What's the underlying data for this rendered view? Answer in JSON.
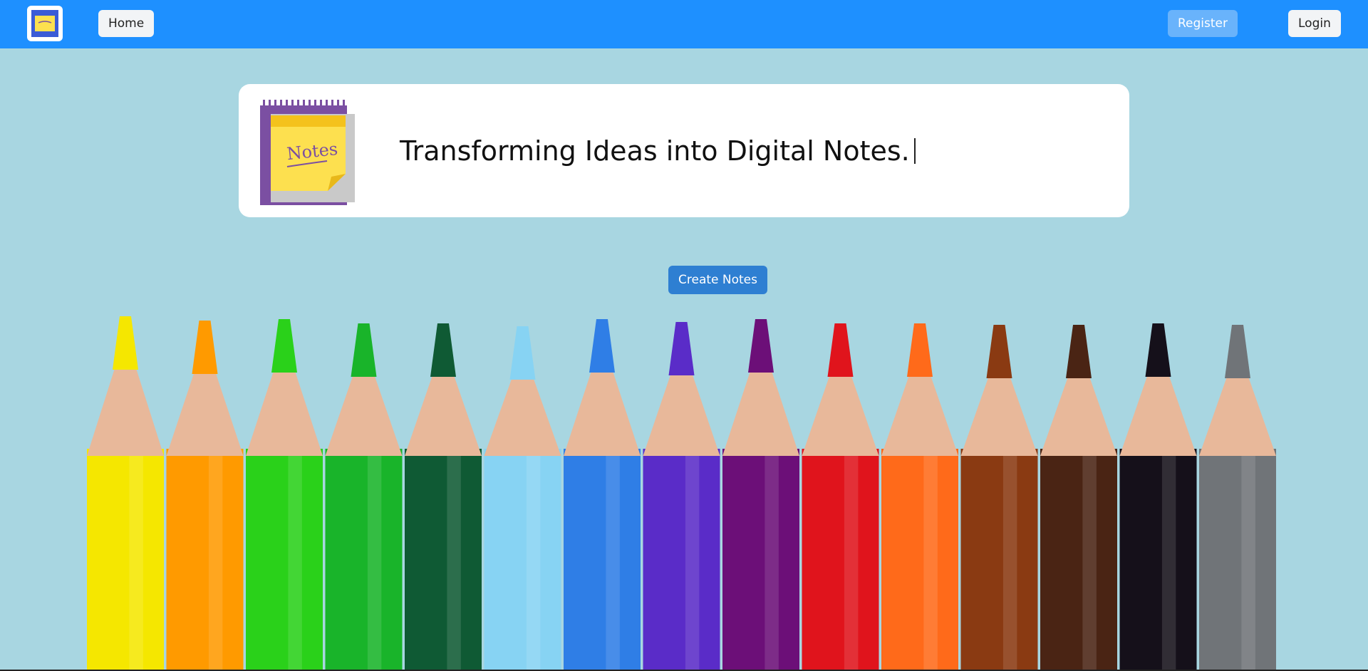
{
  "nav": {
    "logo_icon": "sticky-note-logo-icon",
    "home_label": "Home",
    "register_label": "Register",
    "login_label": "Login"
  },
  "hero": {
    "illustration_text": "Notes",
    "tagline": "Transforming Ideas into Digital Notes."
  },
  "actions": {
    "create_label": "Create Notes"
  },
  "colors": {
    "navbar": "#1e90ff",
    "background": "#a8d6e1",
    "create_button": "#2e7fd2",
    "register_button": "#69b3fb",
    "notepad_purple": "#7b4fa2",
    "sticky_yellow": "#fde04f"
  },
  "pencil_colors": [
    "#f5e700",
    "#ff9a00",
    "#2ad11a",
    "#19b42a",
    "#0f5a34",
    "#87d3f3",
    "#2f7ee6",
    "#5a2cc8",
    "#6c0f78",
    "#e0141c",
    "#ff6a1a",
    "#8a3a12",
    "#4a2414",
    "#15101a",
    "#707478"
  ]
}
